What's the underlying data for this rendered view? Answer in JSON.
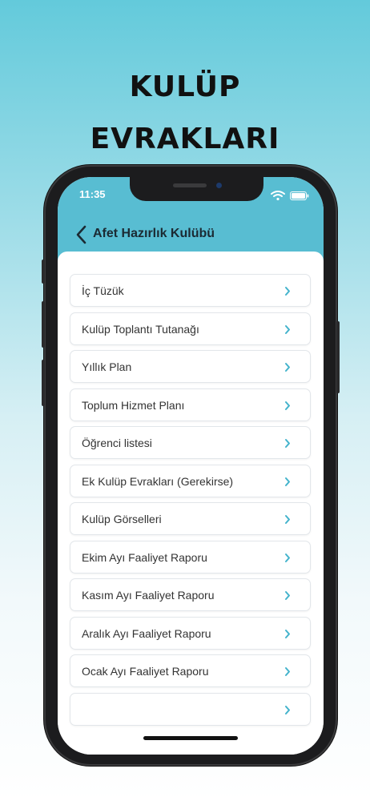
{
  "hero": {
    "line1": "KULÜP",
    "line2": "EVRAKLARI"
  },
  "status_bar": {
    "time": "11:35"
  },
  "nav": {
    "back_icon": "chevron-left-icon",
    "title": "Afet Hazırlık Kulübü"
  },
  "colors": {
    "accent": "#58bdd2",
    "chevron": "#43b3cc",
    "background_top": "#63cadb"
  },
  "documents": [
    "İç Tüzük",
    "Kulüp Toplantı Tutanağı",
    "Yıllık Plan",
    "Toplum Hizmet Planı",
    "Öğrenci listesi",
    "Ek Kulüp Evrakları (Gerekirse)",
    "Kulüp Görselleri",
    "Ekim Ayı Faaliyet Raporu",
    "Kasım Ayı Faaliyet Raporu",
    "Aralık Ayı Faaliyet Raporu",
    "Ocak Ayı Faaliyet Raporu"
  ]
}
